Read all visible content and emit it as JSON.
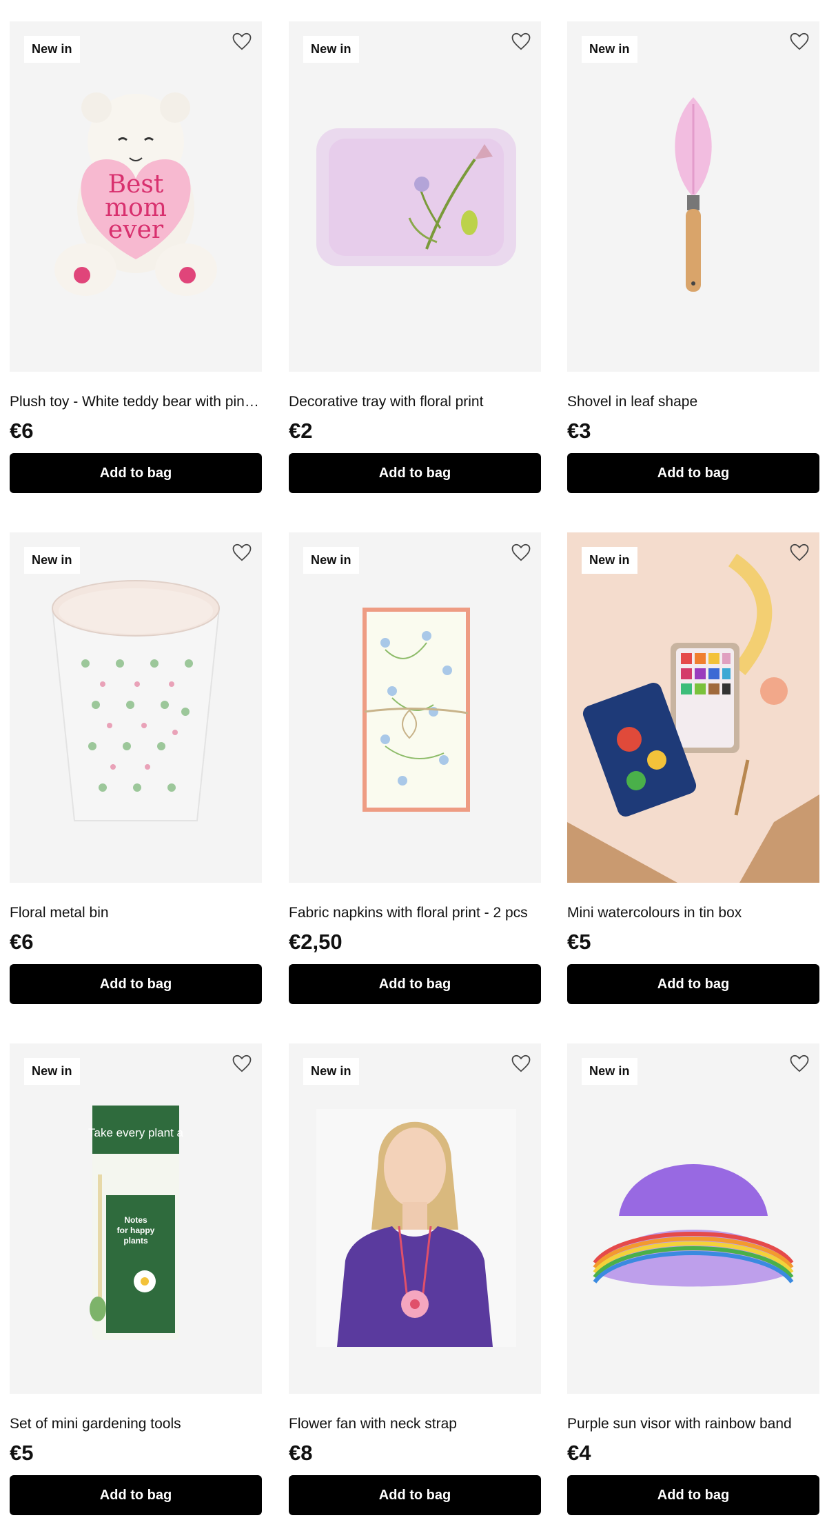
{
  "badge": "New in",
  "button": "Add to bag",
  "products": [
    {
      "title": "Plush toy - White teddy bear with pin…",
      "price": "€6"
    },
    {
      "title": "Decorative tray with floral print",
      "price": "€2"
    },
    {
      "title": "Shovel in leaf shape",
      "price": "€3"
    },
    {
      "title": "Floral metal bin",
      "price": "€6"
    },
    {
      "title": "Fabric napkins with floral print - 2 pcs",
      "price": "€2,50"
    },
    {
      "title": "Mini watercolours in tin box",
      "price": "€5"
    },
    {
      "title": "Set of mini gardening tools",
      "price": "€5"
    },
    {
      "title": "Flower fan with neck strap",
      "price": "€8"
    },
    {
      "title": "Purple sun visor with rainbow band",
      "price": "€4"
    }
  ],
  "images": {
    "bear_text": [
      "Best",
      "mom",
      "ever"
    ],
    "tube_text": "Take every plant a",
    "tube_label": [
      "Notes",
      "for happy",
      "plants"
    ]
  },
  "colors": {
    "button": "#000000",
    "card_bg": "#f4f4f4"
  },
  "icons": {
    "favorite": "heart-outline-icon"
  }
}
